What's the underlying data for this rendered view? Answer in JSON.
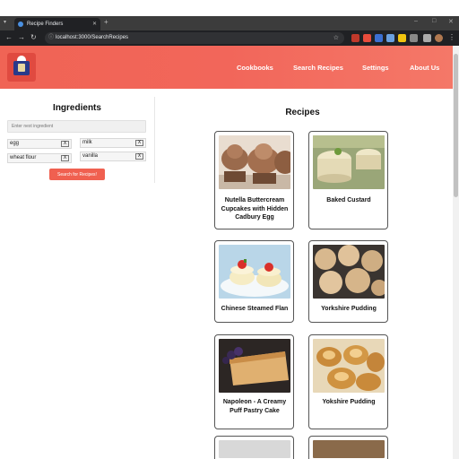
{
  "browser": {
    "tab_title": "Recipe Finders",
    "url": "localhost:3000/SearchRecipes"
  },
  "header": {
    "nav": [
      "Cookbooks",
      "Search Recipes",
      "Settings",
      "About Us"
    ]
  },
  "ingredients": {
    "title": "Ingredients",
    "input_placeholder": "Enter next ingredient",
    "items": [
      "egg",
      "milk",
      "wheat flour",
      "vanilla"
    ],
    "remove_label": "X",
    "search_button": "Search for Recipes!"
  },
  "recipes": {
    "title": "Recipes",
    "cards": [
      {
        "name": "Nutella Buttercream Cupcakes with Hidden Cadbury Egg"
      },
      {
        "name": "Baked Custard"
      },
      {
        "name": "Chinese Steamed Flan"
      },
      {
        "name": "Yorkshire Pudding"
      },
      {
        "name": "Napoleon - A Creamy Puff Pastry Cake"
      },
      {
        "name": "Yokshire Pudding"
      }
    ]
  }
}
